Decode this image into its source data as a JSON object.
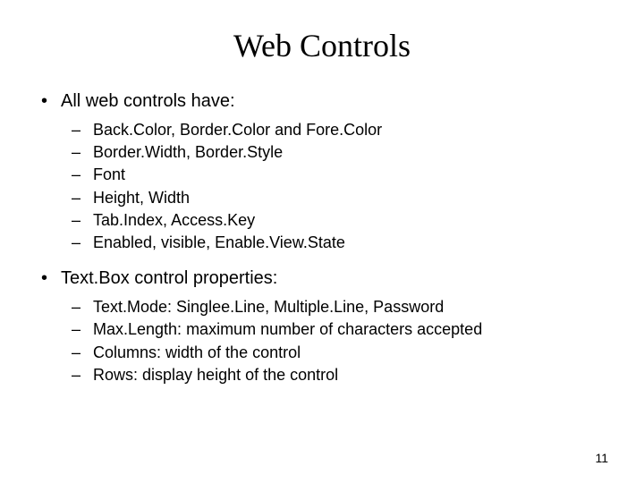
{
  "title": "Web Controls",
  "bullets": [
    {
      "text": "All web controls have:",
      "subitems": [
        "Back.Color, Border.Color and Fore.Color",
        "Border.Width, Border.Style",
        "Font",
        "Height, Width",
        "Tab.Index, Access.Key",
        "Enabled, visible, Enable.View.State"
      ]
    },
    {
      "text": "Text.Box control properties:",
      "subitems": [
        "Text.Mode: Singlee.Line, Multiple.Line, Password",
        "Max.Length: maximum number of characters accepted",
        "Columns: width of the control",
        "Rows: display height of the control"
      ]
    }
  ],
  "pageNumber": "11",
  "markers": {
    "bullet": "•",
    "dash": "–"
  }
}
